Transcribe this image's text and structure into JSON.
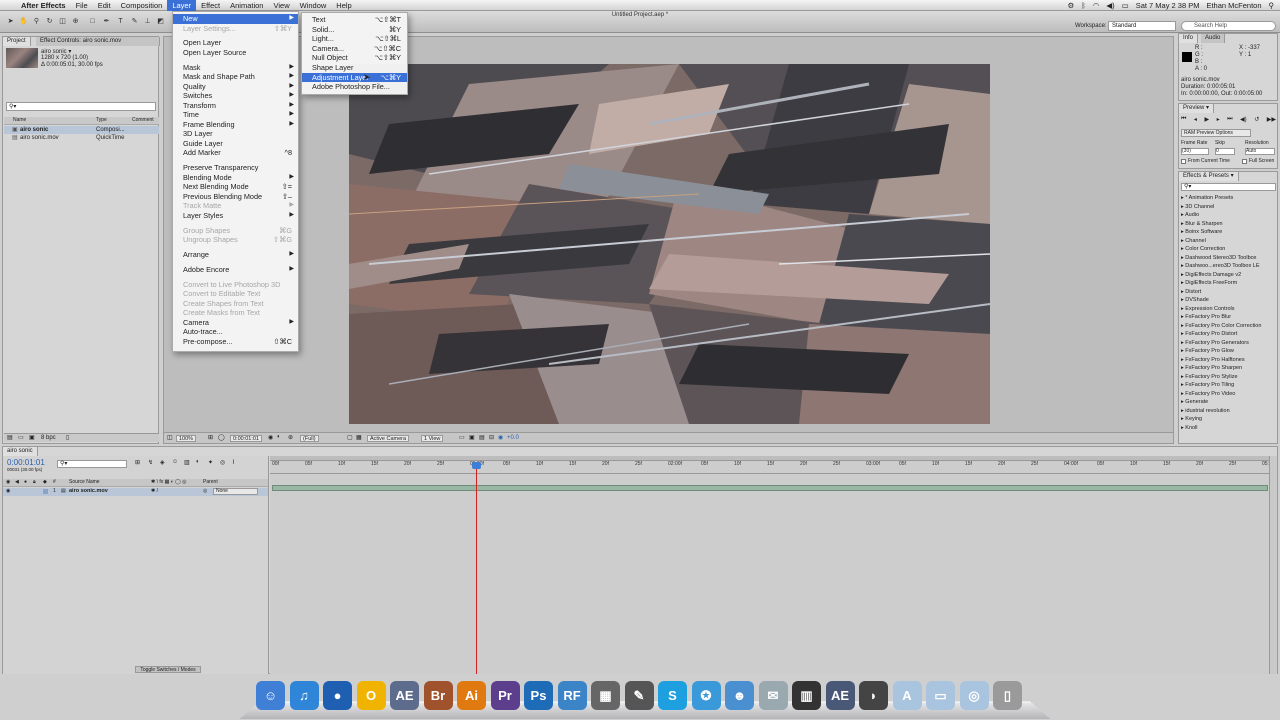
{
  "menubar": {
    "apple": "",
    "app": "After Effects",
    "items": [
      "File",
      "Edit",
      "Composition",
      "Layer",
      "Effect",
      "Animation",
      "View",
      "Window",
      "Help"
    ],
    "active": "Layer",
    "clock": "Sat 7 May  2 38 PM",
    "user": "Ethan McFenton"
  },
  "toolbar": {
    "doc_title": "Untitled Project.aep *",
    "workspace_label": "Workspace:",
    "workspace_value": "Standard",
    "search_placeholder": "Search Help"
  },
  "project": {
    "tab_project": "Project",
    "tab_effect_controls": "Effect Controls: airo sonic.mov",
    "item_name": "airo sonic ▾",
    "item_dims": "1280 x 720 (1.00)",
    "item_dur": "Δ 0:00:05:01, 30.00 fps",
    "search_icon_text": "⚲▾",
    "col_name": "Name",
    "col_type": "Type",
    "col_comment": "Comment",
    "rows": [
      {
        "name": "airo sonic",
        "type": "Composi..."
      },
      {
        "name": "airo sonic.mov",
        "type": "QuickTime"
      }
    ],
    "bpc": "8 bpc"
  },
  "viewer": {
    "zoom": "100%",
    "timecode": "0:00:01:01",
    "resolution": "(Full)",
    "camera": "Active Camera",
    "views": "1 View",
    "exposure": "+0.0"
  },
  "info": {
    "tab_info": "Info",
    "tab_audio": "Audio",
    "r": "R :",
    "g": "G :",
    "b": "B :",
    "a": "A : 0",
    "x": "X : -337",
    "y": "Y : 1",
    "file": "airo sonic.mov",
    "duration": "Duration: 0:00:05:01",
    "inout": "In: 0:00:00:00, Out: 0:00:05:00"
  },
  "preview": {
    "title": "Preview ▾",
    "ram_options": "RAM Preview Options",
    "frame_rate_label": "Frame Rate",
    "skip_label": "Skip",
    "resolution_label": "Resolution",
    "frame_rate": "(30)",
    "skip": "0",
    "resolution": "Auto",
    "from_current": "From Current Time",
    "full_screen": "Full Screen"
  },
  "effects": {
    "title": "Effects & Presets ▾",
    "items": [
      "* Animation Presets",
      "3D Channel",
      "Audio",
      "Blur & Sharpen",
      "Boinx Software",
      "Channel",
      "Color Correction",
      "Dashwood Stereo3D Toolbox",
      "Dashwoo...ereo3D Toolbox LE",
      "DigiEffects Damage v2",
      "DigiEffects FreeForm",
      "Distort",
      "DVShade",
      "Expression Controls",
      "FxFactory Pro Blur",
      "FxFactory Pro Color Correction",
      "FxFactory Pro Distort",
      "FxFactory Pro Generators",
      "FxFactory Pro Glow",
      "FxFactory Pro Halftones",
      "FxFactory Pro Sharpen",
      "FxFactory Pro Stylize",
      "FxFactory Pro Tiling",
      "FxFactory Pro Video",
      "Generate",
      "idustrial revolution",
      "Keying",
      "Knoll"
    ]
  },
  "timeline": {
    "tab": "airo sonic",
    "timecode": "0:00:01:01",
    "fps_sub": "00031 (30.00 fps)",
    "col_source": "Source Name",
    "col_parent": "Parent",
    "layer_num": "1",
    "layer_name": "airo sonic.mov",
    "parent_value": "None",
    "toggle_label": "Toggle Switches / Modes",
    "ticks": [
      "00f",
      "05f",
      "10f",
      "15f",
      "20f",
      "25f",
      "01:00f",
      "05f",
      "10f",
      "15f",
      "20f",
      "25f",
      "02:00f",
      "05f",
      "10f",
      "15f",
      "20f",
      "25f",
      "03:00f",
      "05f",
      "10f",
      "15f",
      "20f",
      "25f",
      "04:00f",
      "05f",
      "10f",
      "15f",
      "20f",
      "25f",
      "05:00"
    ]
  },
  "layer_menu": {
    "items": [
      {
        "label": "New",
        "shortcut": "",
        "submenu": true,
        "highlight": true
      },
      {
        "label": "Layer Settings...",
        "shortcut": "⇧⌘Y",
        "disabled": true
      },
      {
        "sep": true
      },
      {
        "label": "Open Layer",
        "shortcut": ""
      },
      {
        "label": "Open Layer Source",
        "shortcut": ""
      },
      {
        "sep": true
      },
      {
        "label": "Mask",
        "submenu": true
      },
      {
        "label": "Mask and Shape Path",
        "submenu": true
      },
      {
        "label": "Quality",
        "submenu": true
      },
      {
        "label": "Switches",
        "submenu": true
      },
      {
        "label": "Transform",
        "submenu": true
      },
      {
        "label": "Time",
        "submenu": true
      },
      {
        "label": "Frame Blending",
        "submenu": true
      },
      {
        "label": "3D Layer"
      },
      {
        "label": "Guide Layer"
      },
      {
        "label": "Add Marker",
        "shortcut": "^8"
      },
      {
        "sep": true
      },
      {
        "label": "Preserve Transparency"
      },
      {
        "label": "Blending Mode",
        "submenu": true
      },
      {
        "label": "Next Blending Mode",
        "shortcut": "⇧="
      },
      {
        "label": "Previous Blending Mode",
        "shortcut": "⇧–"
      },
      {
        "label": "Track Matte",
        "submenu": true,
        "disabled": true
      },
      {
        "label": "Layer Styles",
        "submenu": true
      },
      {
        "sep": true
      },
      {
        "label": "Group Shapes",
        "shortcut": "⌘G",
        "disabled": true
      },
      {
        "label": "Ungroup Shapes",
        "shortcut": "⇧⌘G",
        "disabled": true
      },
      {
        "sep": true
      },
      {
        "label": "Arrange",
        "submenu": true
      },
      {
        "sep": true
      },
      {
        "label": "Adobe Encore",
        "submenu": true
      },
      {
        "sep": true
      },
      {
        "label": "Convert to Live Photoshop 3D",
        "disabled": true
      },
      {
        "label": "Convert to Editable Text",
        "disabled": true
      },
      {
        "label": "Create Shapes from Text",
        "disabled": true
      },
      {
        "label": "Create Masks from Text",
        "disabled": true
      },
      {
        "label": "Camera",
        "submenu": true
      },
      {
        "label": "Auto-trace..."
      },
      {
        "label": "Pre-compose...",
        "shortcut": "⇧⌘C"
      }
    ]
  },
  "new_submenu": {
    "items": [
      {
        "label": "Text",
        "shortcut": "⌥⇧⌘T"
      },
      {
        "label": "Solid...",
        "shortcut": "⌘Y"
      },
      {
        "label": "Light...",
        "shortcut": "⌥⇧⌘L"
      },
      {
        "label": "Camera...",
        "shortcut": "⌥⇧⌘C"
      },
      {
        "label": "Null Object",
        "shortcut": "⌥⇧⌘Y"
      },
      {
        "label": "Shape Layer",
        "shortcut": ""
      },
      {
        "label": "Adjustment Layer",
        "shortcut": "⌥⌘Y",
        "highlight": true
      },
      {
        "label": "Adobe Photoshop File...",
        "shortcut": ""
      }
    ]
  },
  "dock": {
    "items": [
      {
        "name": "finder-icon",
        "glyph": "☺",
        "color": "#3f7fd6"
      },
      {
        "name": "itunes-icon",
        "glyph": "♫",
        "color": "#2f86d8"
      },
      {
        "name": "firefox-icon",
        "glyph": "●",
        "color": "#1f5fb2"
      },
      {
        "name": "cyberduck-icon",
        "glyph": "O",
        "color": "#f0b400"
      },
      {
        "name": "after-effects-icon",
        "glyph": "AE",
        "color": "#5d6c8c"
      },
      {
        "name": "bridge-icon",
        "glyph": "Br",
        "color": "#a0522d"
      },
      {
        "name": "illustrator-icon",
        "glyph": "Ai",
        "color": "#e07a10"
      },
      {
        "name": "premiere-icon",
        "glyph": "Pr",
        "color": "#5c3e8c"
      },
      {
        "name": "photoshop-icon",
        "glyph": "Ps",
        "color": "#1e6cb8"
      },
      {
        "name": "rf-icon",
        "glyph": "RF",
        "color": "#3c84c8"
      },
      {
        "name": "clapboard-icon",
        "glyph": "▦",
        "color": "#666666"
      },
      {
        "name": "feather-icon",
        "glyph": "✎",
        "color": "#555555"
      },
      {
        "name": "skype-icon",
        "glyph": "S",
        "color": "#1e9fe0"
      },
      {
        "name": "safari-icon",
        "glyph": "✪",
        "color": "#3a9ad9"
      },
      {
        "name": "messenger-icon",
        "glyph": "☻",
        "color": "#4a90d0"
      },
      {
        "name": "preview-icon",
        "glyph": "✉",
        "color": "#9aa8b0"
      },
      {
        "name": "piano-icon",
        "glyph": "▥",
        "color": "#333333"
      },
      {
        "name": "after-effects-2-icon",
        "glyph": "AE",
        "color": "#4a5878"
      },
      {
        "name": "hard-drive-icon",
        "glyph": "◗",
        "color": "#444444"
      },
      {
        "name": "applications-folder-icon",
        "glyph": "A",
        "color": "#a9c4de"
      },
      {
        "name": "documents-folder-icon",
        "glyph": "▭",
        "color": "#a9c4de"
      },
      {
        "name": "downloads-folder-icon",
        "glyph": "◎",
        "color": "#a9c4de"
      },
      {
        "name": "trash-icon",
        "glyph": "▯",
        "color": "#9a9a9a"
      }
    ]
  }
}
